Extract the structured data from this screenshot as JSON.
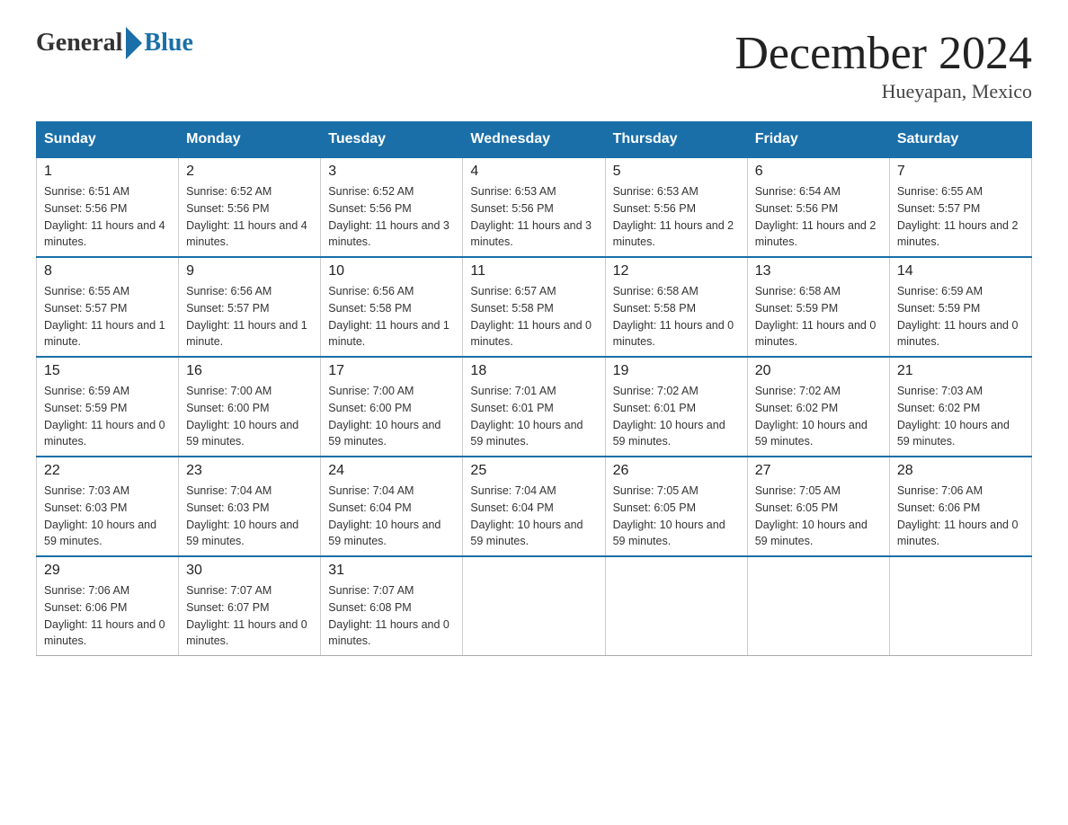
{
  "header": {
    "logo_general": "General",
    "logo_blue": "Blue",
    "month_title": "December 2024",
    "location": "Hueyapan, Mexico"
  },
  "days_of_week": [
    "Sunday",
    "Monday",
    "Tuesday",
    "Wednesday",
    "Thursday",
    "Friday",
    "Saturday"
  ],
  "weeks": [
    [
      {
        "day": "1",
        "sunrise": "6:51 AM",
        "sunset": "5:56 PM",
        "daylight": "11 hours and 4 minutes."
      },
      {
        "day": "2",
        "sunrise": "6:52 AM",
        "sunset": "5:56 PM",
        "daylight": "11 hours and 4 minutes."
      },
      {
        "day": "3",
        "sunrise": "6:52 AM",
        "sunset": "5:56 PM",
        "daylight": "11 hours and 3 minutes."
      },
      {
        "day": "4",
        "sunrise": "6:53 AM",
        "sunset": "5:56 PM",
        "daylight": "11 hours and 3 minutes."
      },
      {
        "day": "5",
        "sunrise": "6:53 AM",
        "sunset": "5:56 PM",
        "daylight": "11 hours and 2 minutes."
      },
      {
        "day": "6",
        "sunrise": "6:54 AM",
        "sunset": "5:56 PM",
        "daylight": "11 hours and 2 minutes."
      },
      {
        "day": "7",
        "sunrise": "6:55 AM",
        "sunset": "5:57 PM",
        "daylight": "11 hours and 2 minutes."
      }
    ],
    [
      {
        "day": "8",
        "sunrise": "6:55 AM",
        "sunset": "5:57 PM",
        "daylight": "11 hours and 1 minute."
      },
      {
        "day": "9",
        "sunrise": "6:56 AM",
        "sunset": "5:57 PM",
        "daylight": "11 hours and 1 minute."
      },
      {
        "day": "10",
        "sunrise": "6:56 AM",
        "sunset": "5:58 PM",
        "daylight": "11 hours and 1 minute."
      },
      {
        "day": "11",
        "sunrise": "6:57 AM",
        "sunset": "5:58 PM",
        "daylight": "11 hours and 0 minutes."
      },
      {
        "day": "12",
        "sunrise": "6:58 AM",
        "sunset": "5:58 PM",
        "daylight": "11 hours and 0 minutes."
      },
      {
        "day": "13",
        "sunrise": "6:58 AM",
        "sunset": "5:59 PM",
        "daylight": "11 hours and 0 minutes."
      },
      {
        "day": "14",
        "sunrise": "6:59 AM",
        "sunset": "5:59 PM",
        "daylight": "11 hours and 0 minutes."
      }
    ],
    [
      {
        "day": "15",
        "sunrise": "6:59 AM",
        "sunset": "5:59 PM",
        "daylight": "11 hours and 0 minutes."
      },
      {
        "day": "16",
        "sunrise": "7:00 AM",
        "sunset": "6:00 PM",
        "daylight": "10 hours and 59 minutes."
      },
      {
        "day": "17",
        "sunrise": "7:00 AM",
        "sunset": "6:00 PM",
        "daylight": "10 hours and 59 minutes."
      },
      {
        "day": "18",
        "sunrise": "7:01 AM",
        "sunset": "6:01 PM",
        "daylight": "10 hours and 59 minutes."
      },
      {
        "day": "19",
        "sunrise": "7:02 AM",
        "sunset": "6:01 PM",
        "daylight": "10 hours and 59 minutes."
      },
      {
        "day": "20",
        "sunrise": "7:02 AM",
        "sunset": "6:02 PM",
        "daylight": "10 hours and 59 minutes."
      },
      {
        "day": "21",
        "sunrise": "7:03 AM",
        "sunset": "6:02 PM",
        "daylight": "10 hours and 59 minutes."
      }
    ],
    [
      {
        "day": "22",
        "sunrise": "7:03 AM",
        "sunset": "6:03 PM",
        "daylight": "10 hours and 59 minutes."
      },
      {
        "day": "23",
        "sunrise": "7:04 AM",
        "sunset": "6:03 PM",
        "daylight": "10 hours and 59 minutes."
      },
      {
        "day": "24",
        "sunrise": "7:04 AM",
        "sunset": "6:04 PM",
        "daylight": "10 hours and 59 minutes."
      },
      {
        "day": "25",
        "sunrise": "7:04 AM",
        "sunset": "6:04 PM",
        "daylight": "10 hours and 59 minutes."
      },
      {
        "day": "26",
        "sunrise": "7:05 AM",
        "sunset": "6:05 PM",
        "daylight": "10 hours and 59 minutes."
      },
      {
        "day": "27",
        "sunrise": "7:05 AM",
        "sunset": "6:05 PM",
        "daylight": "10 hours and 59 minutes."
      },
      {
        "day": "28",
        "sunrise": "7:06 AM",
        "sunset": "6:06 PM",
        "daylight": "11 hours and 0 minutes."
      }
    ],
    [
      {
        "day": "29",
        "sunrise": "7:06 AM",
        "sunset": "6:06 PM",
        "daylight": "11 hours and 0 minutes."
      },
      {
        "day": "30",
        "sunrise": "7:07 AM",
        "sunset": "6:07 PM",
        "daylight": "11 hours and 0 minutes."
      },
      {
        "day": "31",
        "sunrise": "7:07 AM",
        "sunset": "6:08 PM",
        "daylight": "11 hours and 0 minutes."
      },
      null,
      null,
      null,
      null
    ]
  ]
}
